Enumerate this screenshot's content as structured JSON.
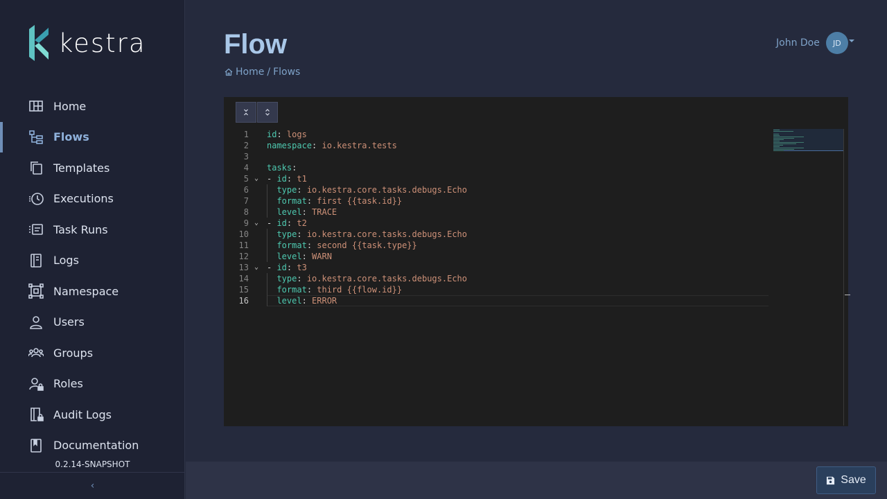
{
  "app": {
    "logo_text": "kestra",
    "version": "0.2.14-SNAPSHOT"
  },
  "sidebar": {
    "items": [
      {
        "label": "Home",
        "icon": "home-icon"
      },
      {
        "label": "Flows",
        "icon": "flows-icon",
        "active": true
      },
      {
        "label": "Templates",
        "icon": "templates-icon"
      },
      {
        "label": "Executions",
        "icon": "executions-icon"
      },
      {
        "label": "Task Runs",
        "icon": "task-runs-icon"
      },
      {
        "label": "Logs",
        "icon": "logs-icon"
      },
      {
        "label": "Namespace",
        "icon": "namespace-icon"
      },
      {
        "label": "Users",
        "icon": "users-icon"
      },
      {
        "label": "Groups",
        "icon": "groups-icon"
      },
      {
        "label": "Roles",
        "icon": "roles-icon"
      },
      {
        "label": "Audit Logs",
        "icon": "audit-logs-icon"
      },
      {
        "label": "Documentation",
        "icon": "documentation-icon"
      }
    ],
    "collapse_glyph": "‹"
  },
  "header": {
    "title": "Flow",
    "breadcrumb": {
      "home": "Home",
      "separator": "/",
      "current": "Flows"
    },
    "user": {
      "name": "John Doe",
      "initials": "JD"
    }
  },
  "editor": {
    "toolbar": {
      "collapse_all_icon": "collapse-all-icon",
      "expand_all_icon": "expand-all-icon"
    },
    "current_line": 16,
    "lines": [
      {
        "n": "1",
        "key": "id",
        "value": "logs"
      },
      {
        "n": "2",
        "key": "namespace",
        "value": "io.kestra.tests"
      },
      {
        "n": "3"
      },
      {
        "n": "4",
        "key": "tasks",
        "value": ""
      },
      {
        "n": "5",
        "prefix": "- ",
        "key": "id",
        "value": "t1",
        "fold": true
      },
      {
        "n": "6",
        "indent": "  ",
        "key": "type",
        "value": "io.kestra.core.tasks.debugs.Echo"
      },
      {
        "n": "7",
        "indent": "  ",
        "key": "format",
        "value": "first {{task.id}}"
      },
      {
        "n": "8",
        "indent": "  ",
        "key": "level",
        "value": "TRACE"
      },
      {
        "n": "9",
        "prefix": "- ",
        "key": "id",
        "value": "t2",
        "fold": true
      },
      {
        "n": "10",
        "indent": "  ",
        "key": "type",
        "value": "io.kestra.core.tasks.debugs.Echo"
      },
      {
        "n": "11",
        "indent": "  ",
        "key": "format",
        "value": "second {{task.type}}"
      },
      {
        "n": "12",
        "indent": "  ",
        "key": "level",
        "value": "WARN"
      },
      {
        "n": "13",
        "prefix": "- ",
        "key": "id",
        "value": "t3",
        "fold": true
      },
      {
        "n": "14",
        "indent": "  ",
        "key": "type",
        "value": "io.kestra.core.tasks.debugs.Echo"
      },
      {
        "n": "15",
        "indent": "  ",
        "key": "format",
        "value": "third {{flow.id}}"
      },
      {
        "n": "16",
        "indent": "  ",
        "key": "level",
        "value": "ERROR"
      }
    ]
  },
  "footer": {
    "save_label": "Save"
  },
  "colors": {
    "accent": "#8fb1db",
    "sidebar_bg": "#1e2233",
    "page_bg": "#252a3d",
    "editor_bg": "#1e1e1e",
    "yaml_key": "#4ec9b0",
    "yaml_value": "#ce9178"
  }
}
